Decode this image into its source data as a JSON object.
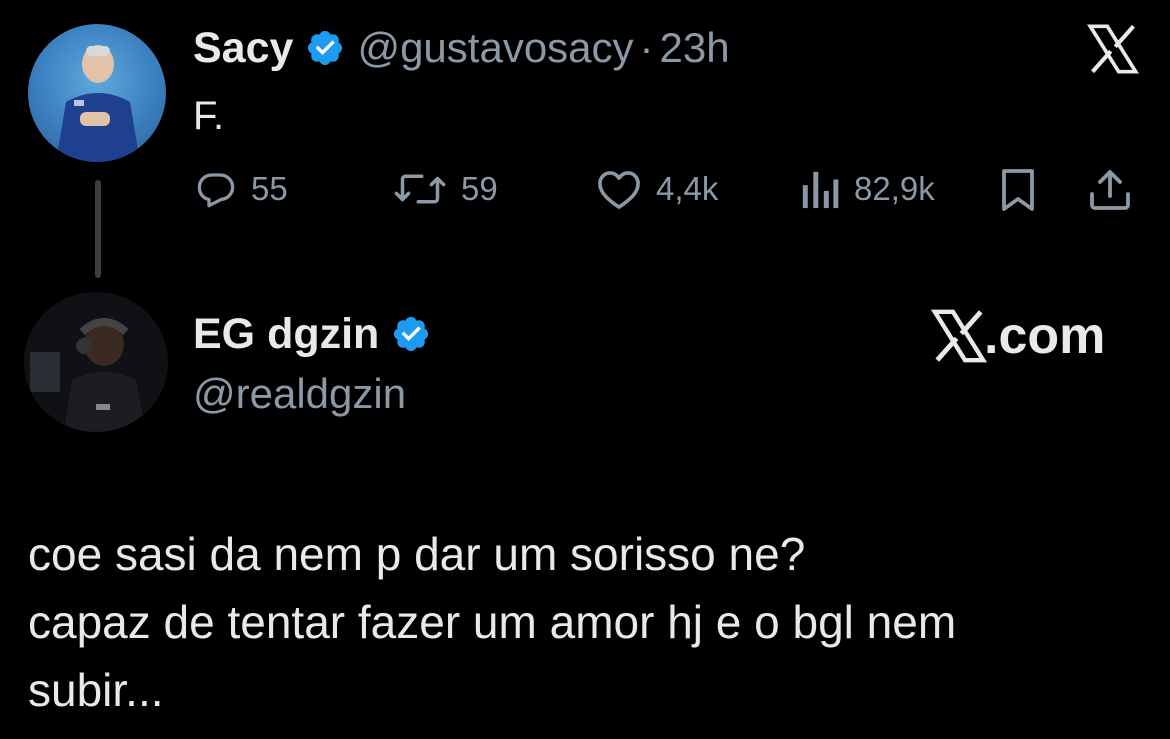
{
  "parent_tweet": {
    "name": "Sacy",
    "handle": "@gustavosacy",
    "separator": "·",
    "time": "23h",
    "text": "F.",
    "stats": {
      "replies": "55",
      "retweets": "59",
      "likes": "4,4k",
      "views": "82,9k"
    }
  },
  "reply_tweet": {
    "name": "EG dgzin",
    "handle": "@realdgzin",
    "brand": "X.com",
    "text_lines": [
      "coe sasi da nem p dar um sorisso ne?",
      "capaz de tentar fazer um amor hj e o bgl nem",
      "subir..."
    ]
  },
  "icons": {
    "verified": "verified-badge-icon",
    "close": "x-logo-icon",
    "reply": "reply-icon",
    "retweet": "retweet-icon",
    "like": "heart-icon",
    "views": "views-icon",
    "bookmark": "bookmark-icon",
    "share": "share-icon"
  },
  "colors": {
    "background": "#000000",
    "text": "#e7e9ea",
    "muted": "#8b98a5",
    "verified": "#1d9bf0"
  }
}
